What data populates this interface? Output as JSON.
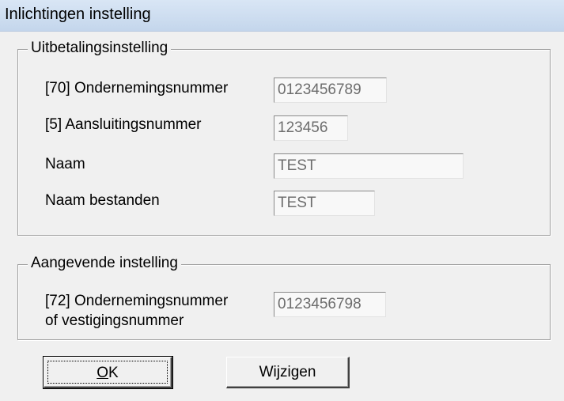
{
  "window": {
    "title": "Inlichtingen instelling"
  },
  "payout_group": {
    "legend": "Uitbetalingsinstelling",
    "fields": [
      {
        "label": "[70] Ondernemingsnummer",
        "value": "0123456789"
      },
      {
        "label": "[5] Aansluitingsnummer",
        "value": "123456"
      },
      {
        "label": "Naam",
        "value": "TEST"
      },
      {
        "label": "Naam bestanden",
        "value": "TEST"
      }
    ]
  },
  "declaring_group": {
    "legend": "Aangevende instelling",
    "fields": [
      {
        "label_line1": "[72] Ondernemingsnummer",
        "label_line2": "of vestigingsnummer",
        "value": "0123456798"
      }
    ]
  },
  "buttons": {
    "ok_mnemonic": "O",
    "ok_rest": "K",
    "change": "Wijzigen"
  }
}
